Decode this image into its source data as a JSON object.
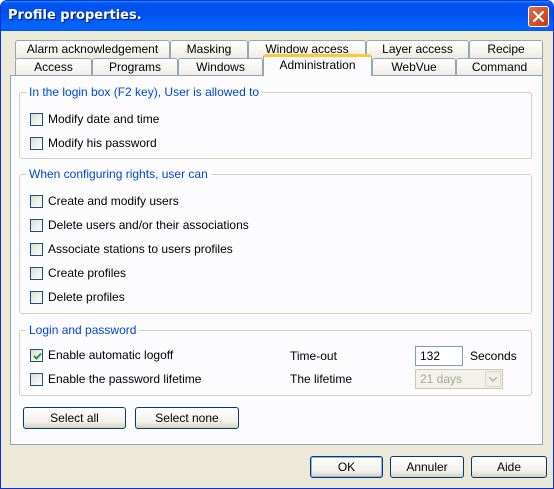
{
  "window": {
    "title": "Profile properties."
  },
  "tabs": {
    "row1": [
      "Alarm acknowledgement",
      "Masking",
      "Window access",
      "Layer access",
      "Recipe"
    ],
    "row2": [
      "Access",
      "Programs",
      "Windows",
      "Administration",
      "WebVue",
      "Command"
    ],
    "active": "Administration"
  },
  "login_box": {
    "title": "In the login box (F2 key), User is allowed to",
    "items": [
      {
        "label": "Modify date and time",
        "checked": false
      },
      {
        "label": "Modify his password",
        "checked": false
      }
    ]
  },
  "rights": {
    "title": "When configuring rights, user can",
    "items": [
      {
        "label": "Create and modify users",
        "checked": false
      },
      {
        "label": "Delete users and/or their associations",
        "checked": false
      },
      {
        "label": "Associate stations to users profiles",
        "checked": false
      },
      {
        "label": "Create profiles",
        "checked": false
      },
      {
        "label": "Delete profiles",
        "checked": false
      }
    ]
  },
  "login_password": {
    "title": "Login and password",
    "auto_logoff": {
      "label": "Enable automatic logoff",
      "checked": true
    },
    "timeout_label": "Time-out",
    "timeout_value": "132",
    "timeout_unit": "Seconds",
    "pw_lifetime": {
      "label": "Enable the password lifetime",
      "checked": false
    },
    "lifetime_label": "The lifetime",
    "lifetime_value": "21 days"
  },
  "buttons": {
    "select_all": "Select all",
    "select_none": "Select none",
    "ok": "OK",
    "cancel": "Annuler",
    "help": "Aide"
  },
  "colors": {
    "accent": "#0046d5",
    "titlebar": "#0054e3",
    "active_tab": "#ffc83c"
  }
}
